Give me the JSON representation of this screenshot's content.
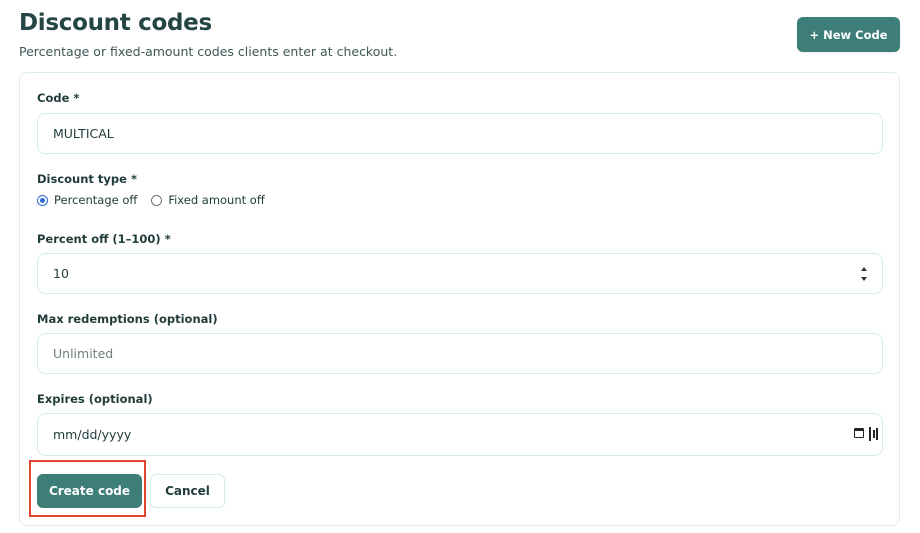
{
  "header": {
    "title": "Discount codes",
    "subtitle": "Percentage or fixed-amount codes clients enter at checkout.",
    "new_code_label": "+ New Code"
  },
  "form": {
    "code": {
      "label": "Code *",
      "value": "MULTICAL"
    },
    "discount_type": {
      "label": "Discount type *",
      "options": [
        {
          "label": "Percentage off",
          "checked": true
        },
        {
          "label": "Fixed amount off",
          "checked": false
        }
      ]
    },
    "percent_off": {
      "label": "Percent off (1–100) *",
      "value": "10"
    },
    "max_redemptions": {
      "label": "Max redemptions (optional)",
      "placeholder": "Unlimited"
    },
    "expires": {
      "label": "Expires (optional)",
      "placeholder": "mm/dd/yyyy"
    }
  },
  "actions": {
    "create_label": "Create code",
    "cancel_label": "Cancel"
  },
  "colors": {
    "accent": "#3d7e79",
    "highlight": "#e0452e",
    "radio_selected": "#2d6bd6"
  }
}
